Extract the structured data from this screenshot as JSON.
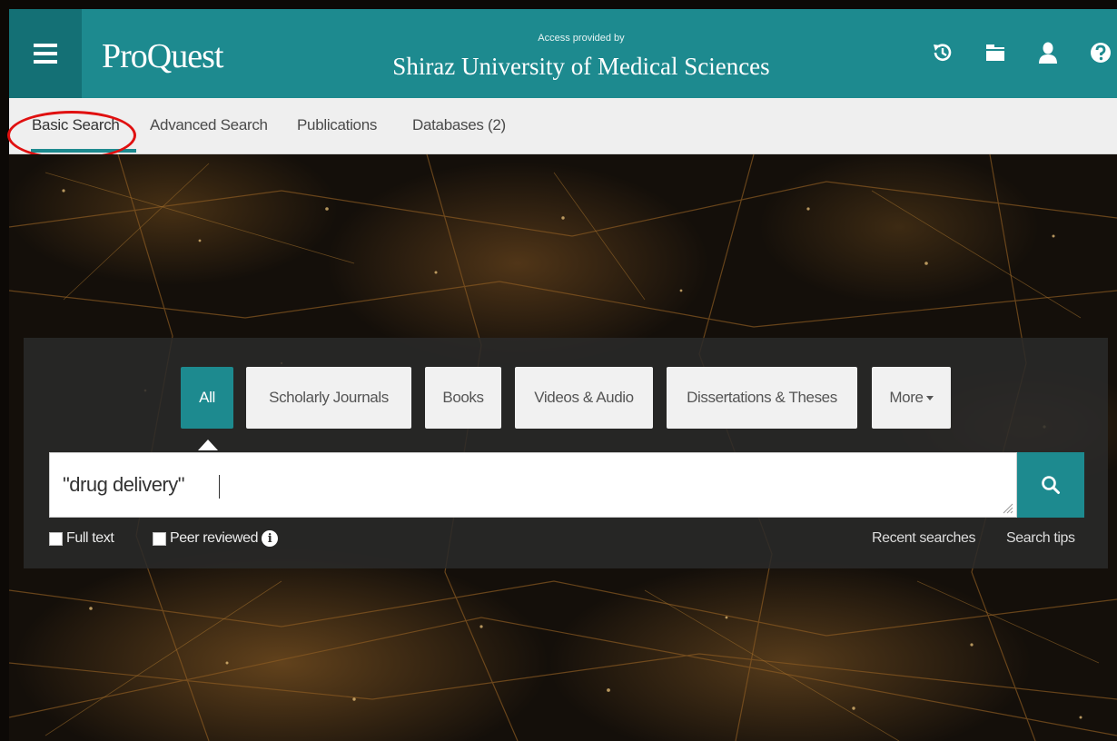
{
  "header": {
    "logo": "ProQuest",
    "access_label": "Access provided by",
    "institution": "Shiraz University of Medical Sciences",
    "icons": [
      "history-icon",
      "folder-icon",
      "user-icon",
      "help-icon"
    ]
  },
  "nav": {
    "items": [
      {
        "label": "Basic Search",
        "active": true
      },
      {
        "label": "Advanced Search"
      },
      {
        "label": "Publications"
      },
      {
        "label": "Databases (2)"
      }
    ]
  },
  "search": {
    "tabs": [
      {
        "label": "All",
        "active": true
      },
      {
        "label": "Scholarly Journals"
      },
      {
        "label": "Books"
      },
      {
        "label": "Videos & Audio"
      },
      {
        "label": "Dissertations & Theses"
      },
      {
        "label": "More"
      }
    ],
    "query": "\"drug delivery\"",
    "options": {
      "full_text": "Full text",
      "peer_reviewed": "Peer reviewed"
    },
    "links": {
      "recent": "Recent searches",
      "tips": "Search tips"
    }
  },
  "colors": {
    "brand": "#1d8a8f",
    "brand_dark": "#147075",
    "nav_bg": "#efefef",
    "annotation": "#e01010"
  }
}
